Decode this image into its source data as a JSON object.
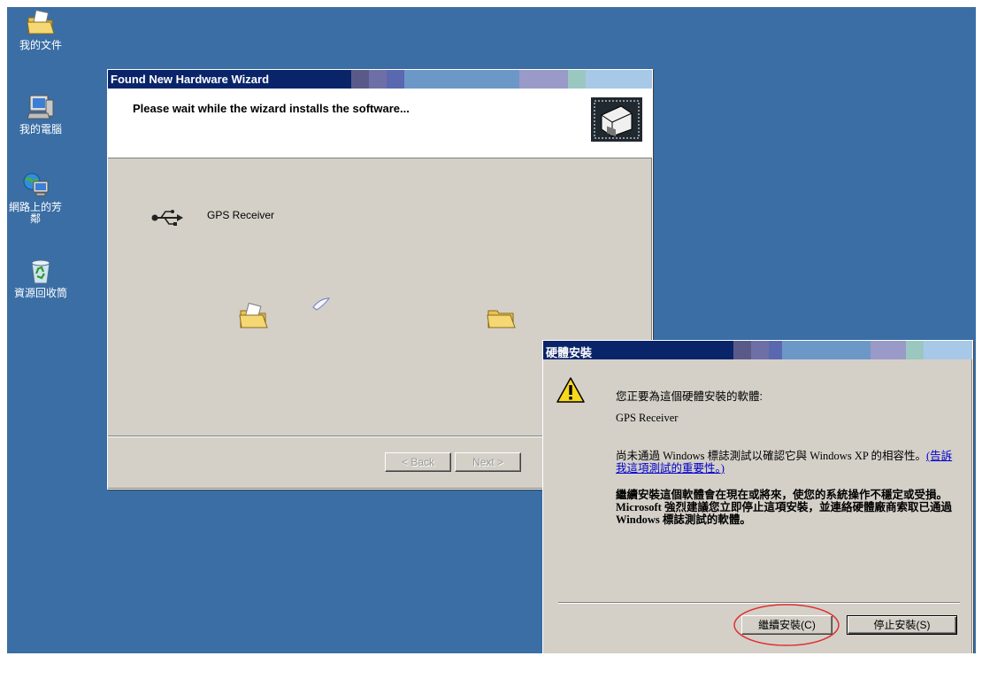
{
  "desktop": {
    "icons": [
      {
        "label": "我的文件",
        "icon": "my-documents-folder"
      },
      {
        "label": "我的電腦",
        "icon": "my-computer"
      },
      {
        "label": "網路上的芳鄰",
        "icon": "network-places"
      },
      {
        "label": "資源回收筒",
        "icon": "recycle-bin"
      }
    ]
  },
  "wizard": {
    "title": "Found New Hardware Wizard",
    "header_text": "Please wait while the wizard installs the software...",
    "device_name": "GPS Receiver",
    "back_label": "< Back",
    "next_label": "Next >",
    "animation_icons": [
      "folder-icon",
      "flying-paper-icon",
      "folder-icon"
    ]
  },
  "dialog": {
    "title": "硬體安裝",
    "line1": "您正要為這個硬體安裝的軟體:",
    "device_name": "GPS Receiver",
    "logo_text": "尚未通過 Windows 標誌測試以確認它與 Windows XP 的相容性。",
    "logo_link": "(告訴我這項測試的重要性。)",
    "warning_text": "繼續安裝這個軟體會在現在或將來，使您的系統操作不穩定或受損。Microsoft 強烈建議您立即停止這項安裝，並連絡硬體廠商索取已通過 Windows 標誌測試的軟體。",
    "continue_label": "繼續安裝(C)",
    "stop_label": "停止安裝(S)",
    "highlight_color": "#e03030"
  },
  "colors": {
    "desktop_bg": "#3a6ea5",
    "title_bg": "#0a246a",
    "window_face": "#d4d0c8"
  }
}
